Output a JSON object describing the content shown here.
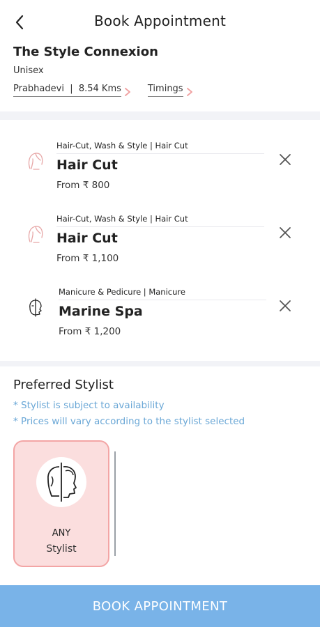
{
  "header": {
    "title": "Book Appointment",
    "back_icon": "chevron-left-icon"
  },
  "salon": {
    "name": "The Style Connexion",
    "type": "Unisex",
    "location": "Prabhadevi",
    "distance": "8.54 Kms",
    "location_text": "Prabhadevi  |  8.54 Kms",
    "timings_label": "Timings"
  },
  "services": [
    {
      "category": "Hair-Cut, Wash & Style | Hair Cut",
      "name": "Hair Cut",
      "price": "From ₹ 800",
      "icon": "hair-icon"
    },
    {
      "category": "Hair-Cut, Wash & Style | Hair Cut",
      "name": "Hair Cut",
      "price": "From ₹ 1,100",
      "icon": "hair-icon"
    },
    {
      "category": "Manicure & Pedicure | Manicure",
      "name": "Marine Spa",
      "price": "From ₹ 1,200",
      "icon": "face-icon"
    }
  ],
  "stylist": {
    "title": "Preferred Stylist",
    "notes": [
      "* Stylist is subject to availability",
      "* Prices will vary according to the stylist selected"
    ],
    "card": {
      "line1": "ANY",
      "line2": "Stylist",
      "icon": "unisex-head-icon"
    }
  },
  "book_button": {
    "label": "BOOK APPOINTMENT"
  },
  "colors": {
    "accent": "#79b3e8",
    "note": "#6aa7d6",
    "card_bg": "#fbdede",
    "card_border": "#f3a5a5",
    "chevron": "#f0a0a0"
  }
}
